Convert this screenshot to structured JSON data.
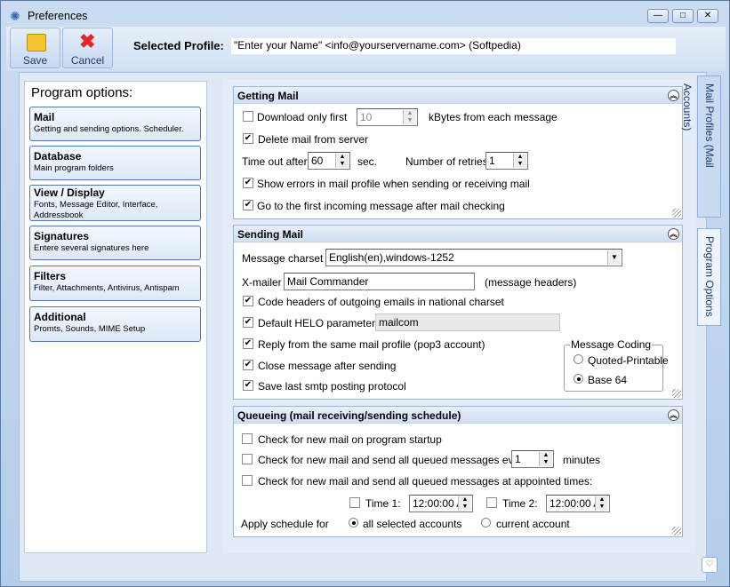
{
  "window": {
    "title": "Preferences",
    "minimize": "—",
    "maximize": "□",
    "close": "✕"
  },
  "toolbar": {
    "save_label": "Save",
    "cancel_label": "Cancel",
    "profile_label": "Selected Profile:",
    "profile_value": "\"Enter your Name\" <info@yourservername.com> (Softpedia)"
  },
  "sidebar": {
    "title": "Program options:",
    "items": [
      {
        "label": "Mail",
        "desc": "Getting and sending options. Scheduler."
      },
      {
        "label": "Database",
        "desc": "Main program folders"
      },
      {
        "label": "View / Display",
        "desc": "Fonts, Message Editor, Interface, Addressbook"
      },
      {
        "label": "Signatures",
        "desc": "Entere several signatures here"
      },
      {
        "label": "Filters",
        "desc": "Filter, Attachments, Antivirus, Antispam"
      },
      {
        "label": "Additional",
        "desc": "Promts, Sounds, MIME Setup"
      }
    ]
  },
  "tabs": [
    "Mail Profiles (Mail Accounts)",
    "Program Options"
  ],
  "getting": {
    "title": "Getting Mail",
    "download_only": {
      "label": "Download only first",
      "checked": false,
      "value": "10",
      "suffix": "kBytes from each message"
    },
    "delete": {
      "label": "Delete mail from server",
      "checked": true
    },
    "timeout": {
      "label": "Time out after",
      "value": "60",
      "suffix": "sec."
    },
    "retries": {
      "label": "Number of retries",
      "value": "1"
    },
    "show_errors": {
      "label": "Show errors in mail profile when sending or receiving mail",
      "checked": true
    },
    "goto_first": {
      "label": "Go to the first incoming message after mail checking",
      "checked": true
    }
  },
  "sending": {
    "title": "Sending Mail",
    "charset": {
      "label": "Message charset",
      "value": "English(en),windows-1252"
    },
    "xmailer": {
      "label": "X-mailer",
      "value": "Mail Commander",
      "suffix": "(message headers)"
    },
    "code_headers": {
      "label": "Code headers of outgoing emails in national charset",
      "checked": true
    },
    "helo": {
      "label": "Default HELO parameter",
      "checked": true,
      "value": "mailcom"
    },
    "reply_same": {
      "label": "Reply from the same mail profile (pop3 account)",
      "checked": true
    },
    "close_after": {
      "label": "Close message after sending",
      "checked": true
    },
    "save_last": {
      "label": "Save last smtp posting protocol",
      "checked": true
    },
    "coding": {
      "title": "Message Coding",
      "options": [
        "Quoted-Printable",
        "Base 64"
      ],
      "selected": "Base 64"
    }
  },
  "queue": {
    "title": "Queueing (mail receiving/sending schedule)",
    "startup": {
      "label": "Check for new mail on program startup",
      "checked": false
    },
    "every": {
      "label": "Check for new mail and send all queued messages every",
      "checked": false,
      "value": "1",
      "suffix": "minutes"
    },
    "appointed": {
      "label": "Check for new mail and send all queued messages at appointed times:",
      "checked": false
    },
    "time1": {
      "label": "Time 1:",
      "checked": false,
      "value": "12:00:00 A"
    },
    "time2": {
      "label": "Time 2:",
      "checked": false,
      "value": "12:00:00 A"
    },
    "apply": {
      "label": "Apply schedule for",
      "options": [
        "all selected accounts",
        "current account"
      ],
      "selected": "all selected accounts"
    }
  },
  "colors": {
    "accent": "#4b78ae",
    "background": "#dfe9f6"
  }
}
